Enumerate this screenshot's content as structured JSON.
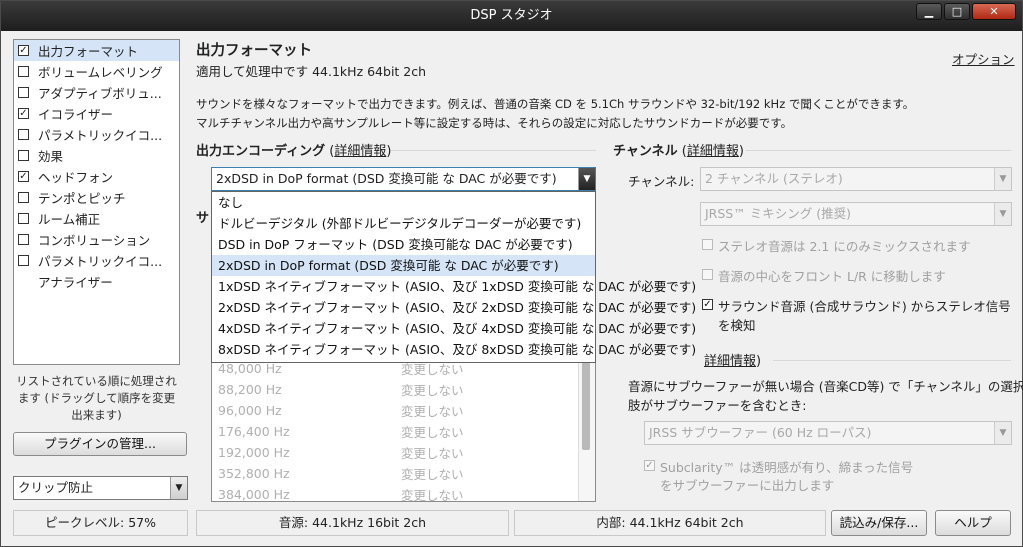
{
  "window": {
    "title": "DSP スタジオ",
    "min_icon": "minimize-icon",
    "max_icon": "maximize-icon",
    "close_icon": "close-icon"
  },
  "sidebar": {
    "items": [
      {
        "label": "出力フォーマット",
        "checked": true,
        "has_checkbox": true,
        "selected": true
      },
      {
        "label": "ボリュームレベリング",
        "checked": false,
        "has_checkbox": true
      },
      {
        "label": "アダプティブボリュ...",
        "checked": false,
        "has_checkbox": true
      },
      {
        "label": "イコライザー",
        "checked": true,
        "has_checkbox": true
      },
      {
        "label": "パラメトリックイコ...",
        "checked": false,
        "has_checkbox": true
      },
      {
        "label": "効果",
        "checked": false,
        "has_checkbox": true
      },
      {
        "label": "ヘッドフォン",
        "checked": true,
        "has_checkbox": true
      },
      {
        "label": "テンポとピッチ",
        "checked": false,
        "has_checkbox": true
      },
      {
        "label": "ルーム補正",
        "checked": false,
        "has_checkbox": true
      },
      {
        "label": "コンボリューション",
        "checked": false,
        "has_checkbox": true
      },
      {
        "label": "パラメトリックイコ...",
        "checked": false,
        "has_checkbox": true
      },
      {
        "label": "アナライザー",
        "checked": false,
        "has_checkbox": false
      }
    ],
    "hint": "リストされている順に処理されます (ドラッグして順序を変更出来ます)",
    "manage_button": "プラグインの管理...",
    "clip_combo": "クリップ防止"
  },
  "main": {
    "title": "出力フォーマット",
    "subtitle": "適用して処理中です 44.1kHz 64bit 2ch",
    "options_link": "オプション",
    "desc_line1": "サウンドを様々なフォーマットで出力できます。例えば、普通の音楽 CD を 5.1Ch サラウンドや 32-bit/192 kHz で聞くことができます。",
    "desc_line2": "マルチチャンネル出力や高サンプルレート等に設定する時は、それらの設定に対応したサウンドカードが必要です。",
    "encoding": {
      "heading": "出力エンコーディング",
      "link": "詳細情報",
      "paren_open": "(",
      "paren_close": ")",
      "selected": "2xDSD in DoP format (DSD 変換可能 な DAC が必要です)",
      "options": [
        "なし",
        "ドルビーデジタル (外部ドルビーデジタルデコーダーが必要です)",
        "DSD in DoP フォーマット (DSD 変換可能な DAC が必要です)",
        "2xDSD in DoP format (DSD 変換可能 な DAC が必要です)",
        "1xDSD ネイティブフォーマット (ASIO、及び 1xDSD 変換可能 な DAC が必要です)",
        "2xDSD ネイティブフォーマット (ASIO、及び 2xDSD 変換可能 な DAC が必要です)",
        "4xDSD ネイティブフォーマット (ASIO、及び 4xDSD 変換可能 な DAC が必要です)",
        "8xDSD ネイティブフォーマット (ASIO、及び 8xDSD 変換可能 な DAC が必要です)"
      ],
      "highlighted_index": 3
    },
    "sample_heading_partial": "サ",
    "rates": [
      {
        "rate": "48,000 Hz",
        "action": "変更しない"
      },
      {
        "rate": "88,200 Hz",
        "action": "変更しない"
      },
      {
        "rate": "96,000 Hz",
        "action": "変更しない"
      },
      {
        "rate": "176,400 Hz",
        "action": "変更しない"
      },
      {
        "rate": "192,000 Hz",
        "action": "変更しない"
      },
      {
        "rate": "352,800 Hz",
        "action": "変更しない"
      },
      {
        "rate": "384,000 Hz",
        "action": "変更しない"
      }
    ]
  },
  "channel": {
    "heading": "チャンネル",
    "link": "詳細情報",
    "paren_open": "(",
    "paren_close": ")",
    "label": "チャンネル:",
    "value": "2 チャンネル (ステレオ)",
    "mix_value": "JRSS™ ミキシング (推奨)",
    "opt1": "ステレオ音源は 2.1 にのみミックスされます",
    "opt2": "音源の中心をフロント L/R に移動します",
    "opt3": "サラウンド音源 (合成サラウンド) からステレオ信号を検知",
    "opt3_line1": "サラウンド音源 (合成サラウンド) からステレオ信号",
    "opt3_line2": "を検知",
    "opt3_checked": true
  },
  "sub": {
    "link": "詳細情報",
    "paren_close": ")",
    "desc_line1": "音源にサブウーファーが無い場合 (音楽CD等) で「チャンネル」の選択",
    "desc_line2": "肢がサブウーファーを含むとき:",
    "value": "JRSS サブウーファー (60 Hz ローパス)",
    "clarity_line1": "Subclarity™ は透明感が有り、締まった信号",
    "clarity_line2": "をサブウーファーに出力します",
    "clarity_checked": true
  },
  "status": {
    "peak": "ピークレベル: 57%",
    "source": "音源: 44.1kHz 16bit 2ch",
    "internal": "内部: 44.1kHz 64bit 2ch",
    "load_save": "読込み/保存...",
    "help": "ヘルプ"
  },
  "icons": {
    "check": "✓",
    "down_arrow": "▼"
  }
}
